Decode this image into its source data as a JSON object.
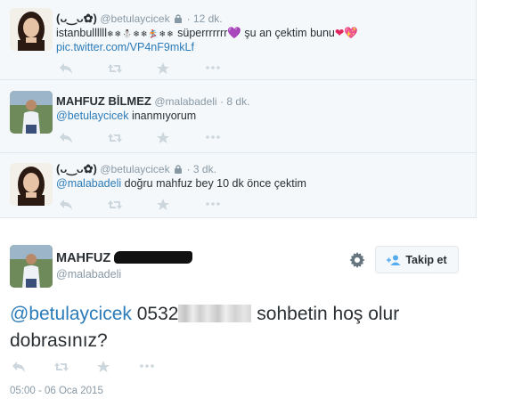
{
  "tweets": [
    {
      "name": "(ᴗ‿ᴗ✿)",
      "handle": "@betulaycicek",
      "time": "12 dk.",
      "text_prefix": "istanbullllll",
      "snow": "❄❄⛄❄❄🏂❄❄",
      "text_mid": " süperrrrrrr",
      "purple_heart": "💜",
      "text_tail": " şu an çektim bunu",
      "hearts": "❤💖",
      "link": "pic.twitter.com/VP4nF9mkLf",
      "avatar": "avatar-girl"
    },
    {
      "name": "MAHFUZ BİLMEZ",
      "handle": "@malabadeli",
      "time": "8 dk.",
      "mention": "@betulaycicek",
      "text": " inanmıyorum",
      "avatar": "avatar-man"
    },
    {
      "name": "(ᴗ‿ᴗ✿)",
      "handle": "@betulaycicek",
      "time": "3 dk.",
      "mention": "@malabadeli",
      "text": " doğru mahfuz bey 10 dk önce çektim",
      "avatar": "avatar-girl"
    }
  ],
  "main": {
    "name": "MAHFUZ",
    "handle": "@malabadeli",
    "follow_label": "Takip et",
    "mention": "@betulaycicek",
    "phone_visible": " 0532",
    "text_after": " sohbetin hoş olur dobrasınız?",
    "timestamp": "05:00 - 06 Oca 2015"
  },
  "icons": [
    "reply-icon",
    "retweet-icon",
    "favorite-icon",
    "more-icon",
    "lock-icon",
    "gear-icon",
    "follow-person-icon"
  ],
  "colors": {
    "link": "#2b7bb9",
    "muted": "#8899a6",
    "icon": "#ccd6dd",
    "thread_bg": "#f5f8fa"
  }
}
